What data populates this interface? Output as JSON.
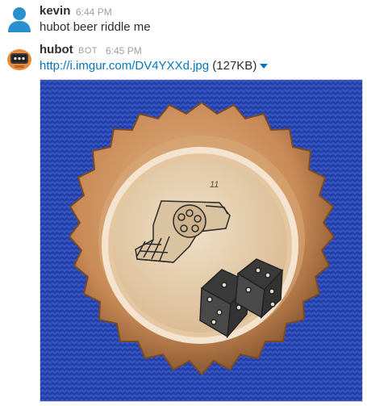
{
  "messages": [
    {
      "author": "kevin",
      "time": "6:44 PM",
      "text": "hubot beer riddle me",
      "avatar_icon": "user-silhouette-icon"
    },
    {
      "author": "hubot",
      "badge": "BOT",
      "time": "6:45 PM",
      "link": "http://i.imgur.com/DV4YXXd.jpg",
      "file_size": "(127KB)",
      "avatar_icon": "hubot-robot-icon",
      "attachment": {
        "cap_number": "11",
        "depicts": [
          "revolver-icon",
          "dice-icon"
        ]
      }
    }
  ],
  "colors": {
    "link": "#0576b9",
    "author": "#2c2d30",
    "meta": "#9e9ea6",
    "knit_background": "#2a48b5",
    "cap_copper": "#c98a57",
    "cap_inner": "#e6ceb0"
  }
}
